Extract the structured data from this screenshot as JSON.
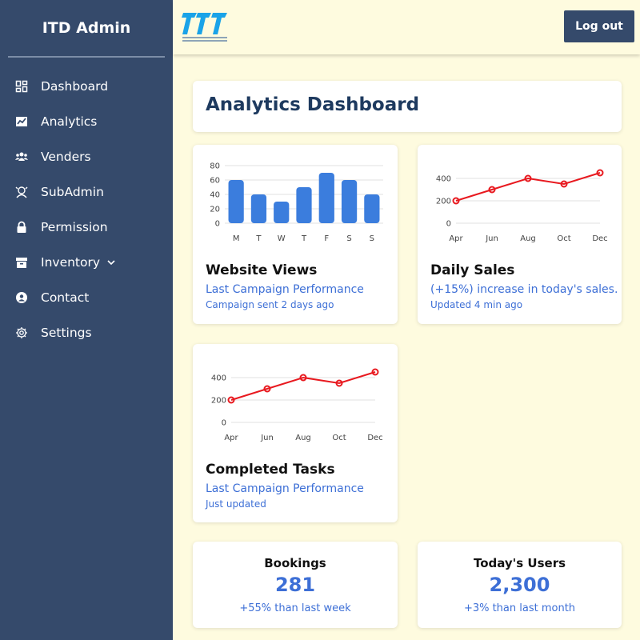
{
  "sidebar": {
    "brand": "ITD Admin",
    "items": [
      {
        "label": "Dashboard",
        "icon": "dashboard-grid-icon"
      },
      {
        "label": "Analytics",
        "icon": "analytics-chart-icon"
      },
      {
        "label": "Venders",
        "icon": "users-group-icon"
      },
      {
        "label": "SubAdmin",
        "icon": "user-admin-icon"
      },
      {
        "label": "Permission",
        "icon": "lock-icon"
      },
      {
        "label": "Inventory",
        "icon": "archive-box-icon",
        "has_dropdown": true
      },
      {
        "label": "Contact",
        "icon": "contact-icon"
      },
      {
        "label": "Settings",
        "icon": "gear-icon"
      }
    ]
  },
  "topbar": {
    "logout_label": "Log out",
    "logo_icon": "itd-logo"
  },
  "main": {
    "title": "Analytics Dashboard"
  },
  "cards": {
    "website_views": {
      "title": "Website Views",
      "subtitle": "Last Campaign Performance",
      "note": "Campaign sent 2 days ago"
    },
    "daily_sales": {
      "title": "Daily Sales",
      "subtitle": "(+15%) increase in today's sales.",
      "note": "Updated 4 min ago"
    },
    "completed_tasks": {
      "title": "Completed Tasks",
      "subtitle": "Last Campaign Performance",
      "note": "Just updated"
    }
  },
  "stats": {
    "bookings": {
      "label": "Bookings",
      "value": "281",
      "change": "+55% than last week"
    },
    "users": {
      "label": "Today's Users",
      "value": "2,300",
      "change": "+3% than last month"
    }
  },
  "colors": {
    "sidebar": "#354a6b",
    "background": "#fefbdf",
    "accent_blue": "#3d6fd6",
    "bar_blue": "#3b7ddd",
    "line_red": "#e8191f",
    "title_navy": "#1e3a5f"
  },
  "chart_data": [
    {
      "id": "website_views",
      "type": "bar",
      "categories": [
        "M",
        "T",
        "W",
        "T",
        "F",
        "S",
        "S"
      ],
      "values": [
        60,
        40,
        30,
        50,
        70,
        60,
        40
      ],
      "yticks": [
        0,
        20,
        40,
        60,
        80
      ],
      "ylim": [
        0,
        80
      ],
      "grid": true
    },
    {
      "id": "daily_sales",
      "type": "line",
      "categories": [
        "Apr",
        "Jun",
        "Aug",
        "Oct",
        "Dec"
      ],
      "values": [
        200,
        300,
        400,
        350,
        450
      ],
      "yticks": [
        0,
        200,
        400
      ],
      "ylim": [
        0,
        500
      ],
      "grid": true
    },
    {
      "id": "completed_tasks",
      "type": "line",
      "categories": [
        "Apr",
        "Jun",
        "Aug",
        "Oct",
        "Dec"
      ],
      "values": [
        200,
        300,
        400,
        350,
        450
      ],
      "yticks": [
        0,
        200,
        400
      ],
      "ylim": [
        0,
        500
      ],
      "grid": true
    }
  ]
}
